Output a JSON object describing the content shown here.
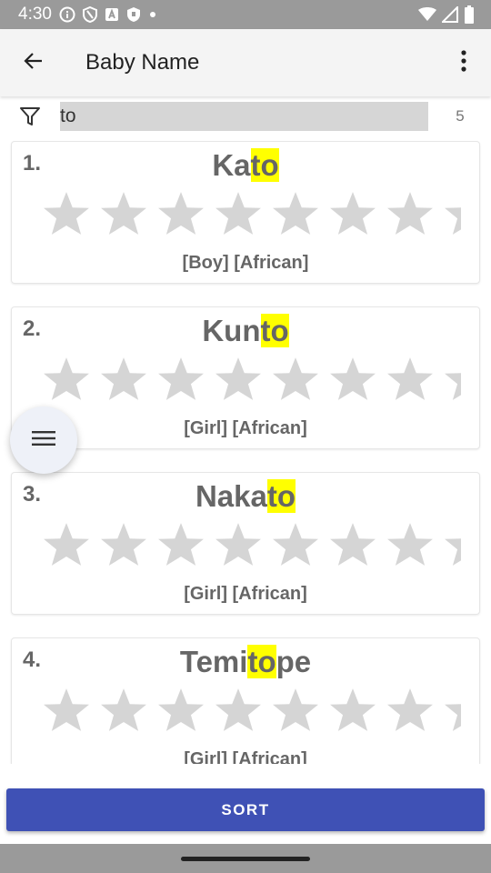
{
  "status_bar": {
    "time": "4:30",
    "left_icons": [
      "info-icon",
      "shield-icon",
      "a-box-icon",
      "shield-small-icon",
      "dot-icon"
    ],
    "right_icons": [
      "wifi-icon",
      "signal-icon",
      "battery-icon"
    ]
  },
  "app_bar": {
    "title": "Baby Name",
    "back_icon": "arrow-back-icon",
    "menu_icon": "more-vert-icon"
  },
  "filter": {
    "icon": "filter-icon",
    "value": "to",
    "count": "5"
  },
  "cards": [
    {
      "index": "1.",
      "name_pre": "Ka",
      "name_match": "to",
      "name_post": "",
      "rating": 0,
      "tags": "[Boy] [African]"
    },
    {
      "index": "2.",
      "name_pre": "Kun",
      "name_match": "to",
      "name_post": "",
      "rating": 0,
      "tags": "[Girl] [African]"
    },
    {
      "index": "3.",
      "name_pre": "Naka",
      "name_match": "to",
      "name_post": "",
      "rating": 0,
      "tags": "[Girl] [African]"
    },
    {
      "index": "4.",
      "name_pre": "Temi",
      "name_match": "to",
      "name_post": "pe",
      "rating": 0,
      "tags": "[Girl] [African]"
    }
  ],
  "fab": {
    "icon": "menu-icon"
  },
  "sort_button": {
    "label": "SORT"
  },
  "colors": {
    "accent": "#3f51b5",
    "highlight": "#ffff00",
    "star_empty": "#d5d5d5",
    "status_bar": "#9a9a9a",
    "app_bar": "#f4f4f4"
  }
}
